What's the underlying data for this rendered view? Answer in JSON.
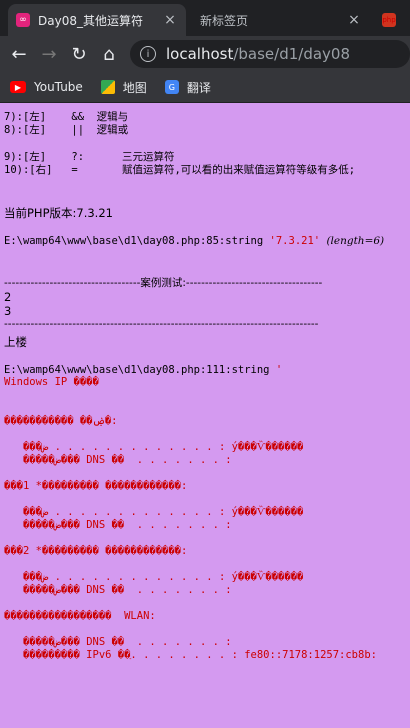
{
  "tabs": [
    {
      "title": "Day08_其他运算符",
      "close": "×",
      "favicon": "∞"
    },
    {
      "title": "新标签页",
      "close": "×"
    },
    {
      "favicon": "php"
    }
  ],
  "toolbar": {
    "back": "←",
    "forward": "→",
    "reload": "↻",
    "home": "⌂",
    "info": "i",
    "url_host": "localhost",
    "url_path": "/base/d1/day08"
  },
  "bookmarks": [
    {
      "label": "YouTube",
      "icon": "youtube-icon"
    },
    {
      "label": "地图",
      "icon": "maps-icon"
    },
    {
      "label": "翻译",
      "icon": "translate-icon"
    }
  ],
  "page": {
    "ops1": "7):[左]    &&  逻辑与\n8):[左]    ||  逻辑或",
    "ops2": "9):[左]    ?:      三元运算符\n10):[右]   =       赋值运算符,可以看的出来赋值运算符等级有多低;",
    "php_version": "当前PHP版本:7.3.21",
    "dump1_path": "E:\\wamp64\\www\\base\\d1\\day08.php:85:",
    "dump1_type": "string",
    "dump1_value": "'7.3.21'",
    "dump1_len": "(length=6)",
    "case_divider": "------------------------------------案例测试:------------------------------------",
    "line2": "2",
    "line3": "3",
    "divider2": "-----------------------------------------------------------------------------------",
    "upstairs": "上楼",
    "dump2_path": "E:\\wamp64\\www\\base\\d1\\day08.php:111:",
    "dump2_type": "string",
    "dump2_value": "'",
    "ipconfig": "Windows IP ����\n\n\n����������� ��ۻ�:\n\n   ���ض . . . . . . . . . . . . . : ý���Ѷ������\n   �����ض��� DNS ��  . . . . . . . :\n\n���1 *��������� ������������:\n\n   ���ض . . . . . . . . . . . . . : ý���Ѷ������\n   �����ض��� DNS ��  . . . . . . . :\n\n���2 *��������� ������������:\n\n   ���ض . . . . . . . . . . . . . : ý���Ѷ������\n   �����ض��� DNS ��  . . . . . . . :\n\n�����������������  WLAN:\n\n   �����ض��� DNS ��  . . . . . . . :\n   ��������� IPv6 ��ַ. . . . . . . . : fe80::7178:1257:cb8b:"
  }
}
